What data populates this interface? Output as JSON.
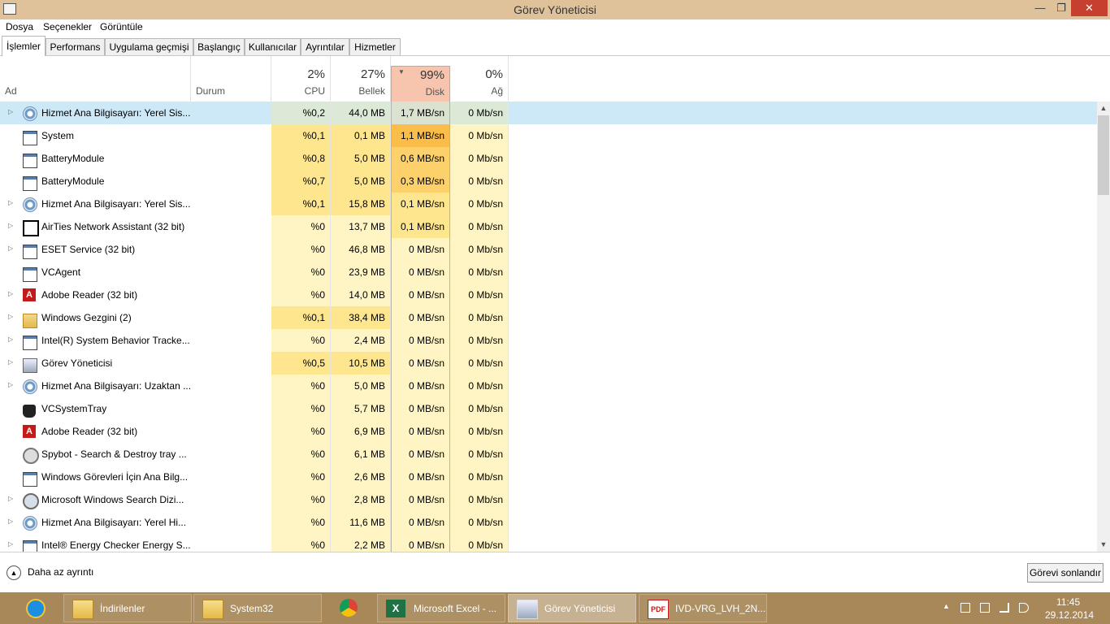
{
  "window": {
    "title": "Görev Yöneticisi",
    "minimize": "—",
    "maximize": "❐",
    "close": "✕"
  },
  "menu": [
    "Dosya",
    "Seçenekler",
    "Görüntüle"
  ],
  "tabs": [
    "İşlemler",
    "Performans",
    "Uygulama geçmişi",
    "Başlangıç",
    "Kullanıcılar",
    "Ayrıntılar",
    "Hizmetler"
  ],
  "header": {
    "name": "Ad",
    "status": "Durum",
    "cpu": {
      "pct": "2%",
      "label": "CPU"
    },
    "memory": {
      "pct": "27%",
      "label": "Bellek"
    },
    "disk": {
      "pct": "99%",
      "label": "Disk"
    },
    "network": {
      "pct": "0%",
      "label": "Ağ"
    }
  },
  "processes": [
    {
      "name": "Hizmet Ana Bilgisayarı: Yerel Sis...",
      "icon": "gear-icon",
      "expand": true,
      "cpu": "%0,2",
      "mem": "44,0 MB",
      "disk": "1,7 MB/sn",
      "net": "0 Mb/sn"
    },
    {
      "name": "System",
      "icon": "window-icon",
      "expand": false,
      "cpu": "%0,1",
      "mem": "0,1 MB",
      "disk": "1,1 MB/sn",
      "net": "0 Mb/sn"
    },
    {
      "name": "BatteryModule",
      "icon": "window-icon",
      "expand": false,
      "cpu": "%0,8",
      "mem": "5,0 MB",
      "disk": "0,6 MB/sn",
      "net": "0 Mb/sn"
    },
    {
      "name": "BatteryModule",
      "icon": "window-icon",
      "expand": false,
      "cpu": "%0,7",
      "mem": "5,0 MB",
      "disk": "0,3 MB/sn",
      "net": "0 Mb/sn"
    },
    {
      "name": "Hizmet Ana Bilgisayarı: Yerel Sis...",
      "icon": "gear-icon",
      "expand": true,
      "cpu": "%0,1",
      "mem": "15,8 MB",
      "disk": "0,1 MB/sn",
      "net": "0 Mb/sn"
    },
    {
      "name": "AirTies Network Assistant (32 bit)",
      "icon": "airties-icon",
      "expand": true,
      "cpu": "%0",
      "mem": "13,7 MB",
      "disk": "0,1 MB/sn",
      "net": "0 Mb/sn"
    },
    {
      "name": "ESET Service (32 bit)",
      "icon": "window-icon",
      "expand": true,
      "cpu": "%0",
      "mem": "46,8 MB",
      "disk": "0 MB/sn",
      "net": "0 Mb/sn"
    },
    {
      "name": "VCAgent",
      "icon": "window-icon",
      "expand": false,
      "cpu": "%0",
      "mem": "23,9 MB",
      "disk": "0 MB/sn",
      "net": "0 Mb/sn"
    },
    {
      "name": "Adobe Reader (32 bit)",
      "icon": "adobe-icon",
      "expand": true,
      "cpu": "%0",
      "mem": "14,0 MB",
      "disk": "0 MB/sn",
      "net": "0 Mb/sn"
    },
    {
      "name": "Windows Gezgini (2)",
      "icon": "folder-icon",
      "expand": true,
      "cpu": "%0,1",
      "mem": "38,4 MB",
      "disk": "0 MB/sn",
      "net": "0 Mb/sn"
    },
    {
      "name": "Intel(R) System Behavior Tracke...",
      "icon": "window-icon",
      "expand": true,
      "cpu": "%0",
      "mem": "2,4 MB",
      "disk": "0 MB/sn",
      "net": "0 Mb/sn"
    },
    {
      "name": "Görev Yöneticisi",
      "icon": "task-manager-icon",
      "expand": true,
      "cpu": "%0,5",
      "mem": "10,5 MB",
      "disk": "0 MB/sn",
      "net": "0 Mb/sn"
    },
    {
      "name": "Hizmet Ana Bilgisayarı: Uzaktan ...",
      "icon": "gear-icon",
      "expand": true,
      "cpu": "%0",
      "mem": "5,0 MB",
      "disk": "0 MB/sn",
      "net": "0 Mb/sn"
    },
    {
      "name": "VCSystemTray",
      "icon": "vc-tray-icon",
      "expand": false,
      "cpu": "%0",
      "mem": "5,7 MB",
      "disk": "0 MB/sn",
      "net": "0 Mb/sn"
    },
    {
      "name": "Adobe Reader (32 bit)",
      "icon": "adobe-icon",
      "expand": false,
      "cpu": "%0",
      "mem": "6,9 MB",
      "disk": "0 MB/sn",
      "net": "0 Mb/sn"
    },
    {
      "name": "Spybot - Search & Destroy tray ...",
      "icon": "spybot-icon",
      "expand": false,
      "cpu": "%0",
      "mem": "6,1 MB",
      "disk": "0 MB/sn",
      "net": "0 Mb/sn"
    },
    {
      "name": "Windows Görevleri İçin Ana Bilg...",
      "icon": "window-icon",
      "expand": false,
      "cpu": "%0",
      "mem": "2,6 MB",
      "disk": "0 MB/sn",
      "net": "0 Mb/sn"
    },
    {
      "name": "Microsoft Windows Search Dizi...",
      "icon": "search-indexer-icon",
      "expand": true,
      "cpu": "%0",
      "mem": "2,8 MB",
      "disk": "0 MB/sn",
      "net": "0 Mb/sn"
    },
    {
      "name": "Hizmet Ana Bilgisayarı: Yerel Hi...",
      "icon": "gear-icon",
      "expand": true,
      "cpu": "%0",
      "mem": "11,6 MB",
      "disk": "0 MB/sn",
      "net": "0 Mb/sn"
    },
    {
      "name": "Intel® Energy Checker Energy S...",
      "icon": "window-icon",
      "expand": true,
      "cpu": "%0",
      "mem": "2,2 MB",
      "disk": "0 MB/sn",
      "net": "0 Mb/sn"
    }
  ],
  "footer": {
    "less_details": "Daha az ayrıntı",
    "end_task": "Görevi sonlandır"
  },
  "taskbar": {
    "items": [
      {
        "label": "",
        "icon": "ie-icon"
      },
      {
        "label": "İndirilenler",
        "icon": "folder-download-icon"
      },
      {
        "label": "System32",
        "icon": "folder-icon"
      },
      {
        "label": "",
        "icon": "chrome-icon"
      },
      {
        "label": "Microsoft Excel - ...",
        "icon": "excel-icon"
      },
      {
        "label": "Görev Yöneticisi",
        "icon": "task-manager-icon"
      },
      {
        "label": "IVD-VRG_LVH_2N...",
        "icon": "pdf-icon"
      }
    ],
    "time": "11:45",
    "date": "29.12.2014"
  },
  "colors": {
    "title_bar": "#e0c29a",
    "taskbar": "#a88758",
    "selected_row": "#cde8f7",
    "disk_header": "#f7c4ae",
    "heat_low": "#fff4c4",
    "heat_mid": "#fde68e",
    "heat_high": "#fcd06a",
    "heat_top": "#fbbd4a"
  }
}
